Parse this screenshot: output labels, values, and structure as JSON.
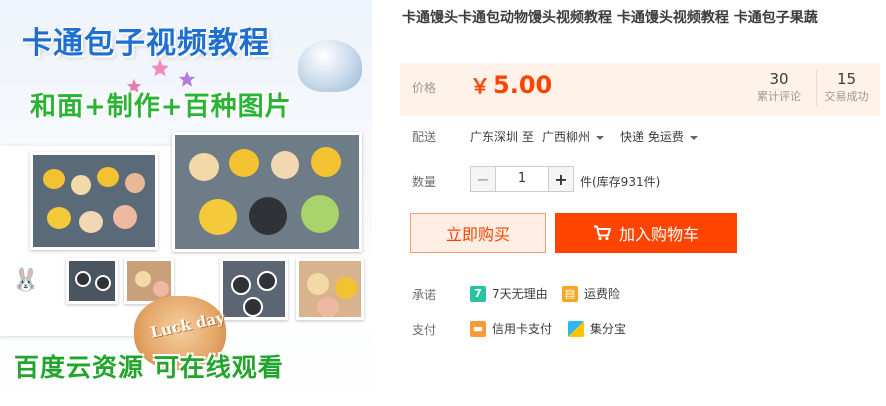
{
  "gallery": {
    "headline": "卡通包子视频教程",
    "subheadline": "和面+制作+百种图片",
    "footer_banner": "百度云资源 可在线观看",
    "cookie_text": "Luck day"
  },
  "product": {
    "title": "卡通馒头卡通包动物馒头视频教程 卡通馒头视频教程 卡通包子果蔬",
    "price_label": "价格",
    "currency_symbol": "￥",
    "price": "5.00",
    "reviews_count": "30",
    "reviews_label": "累计评论",
    "deals_count": "15",
    "deals_label": "交易成功"
  },
  "shipping": {
    "label": "配送",
    "from": "广东深圳 至",
    "to": "广西柳州",
    "method": "快递 免运费"
  },
  "quantity": {
    "label": "数量",
    "value": "1",
    "minus": "−",
    "plus": "+",
    "stock": "件(库存931件)"
  },
  "actions": {
    "buy_now": "立即购买",
    "add_to_cart": "加入购物车"
  },
  "promise": {
    "label": "承诺",
    "items": [
      "7天无理由",
      "运费险"
    ]
  },
  "payment": {
    "label": "支付",
    "items": [
      "信用卡支付",
      "集分宝"
    ]
  },
  "colors": {
    "accent": "#ff4400",
    "price_bg": "#fff2e8",
    "headline_blue": "#1e6fd0",
    "headline_green": "#2bb335"
  }
}
